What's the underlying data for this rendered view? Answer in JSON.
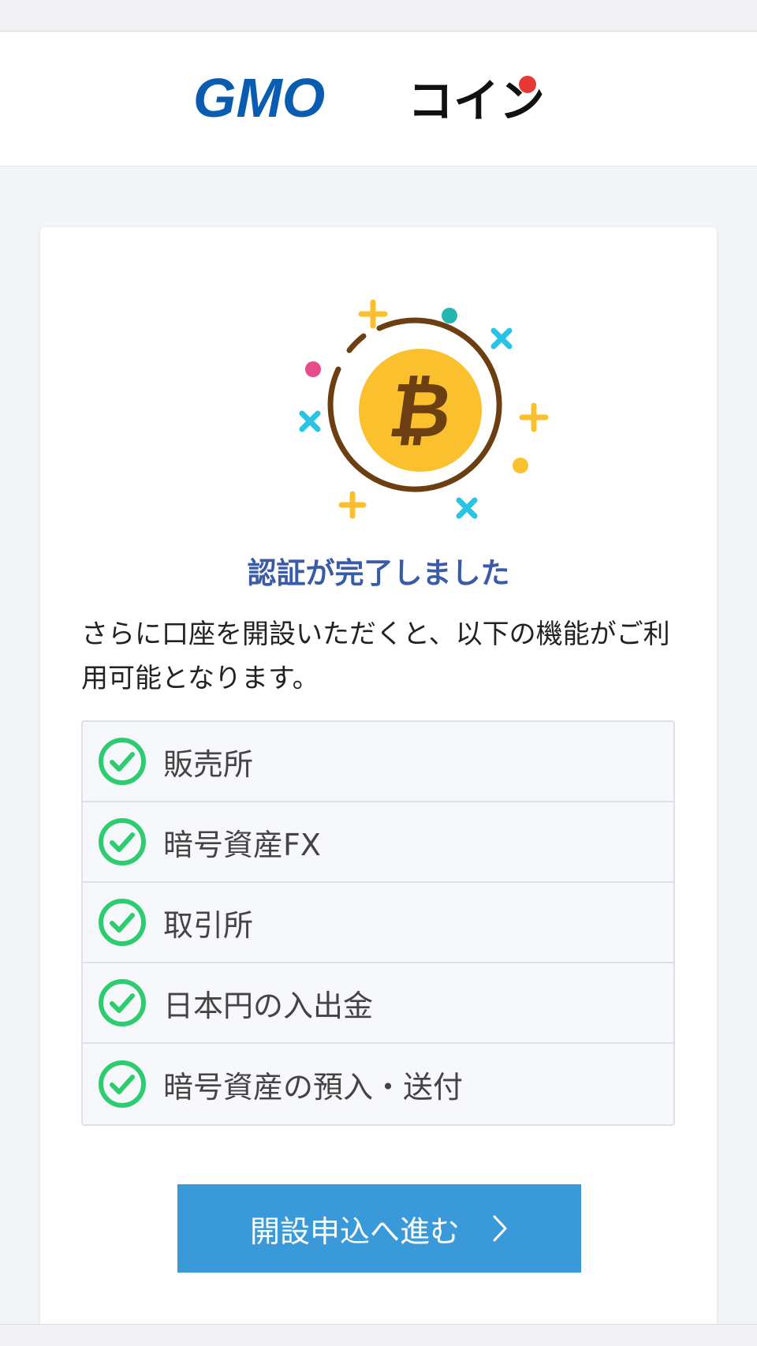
{
  "header": {
    "logo_text_latin": "GMO",
    "logo_text_kana": "コイン",
    "logo_name": "gmo-coin-logo"
  },
  "main": {
    "title": "認証が完了しました",
    "description": "さらに口座を開設いただくと、以下の機能がご利用可能となります。",
    "features": [
      "販売所",
      "暗号資産FX",
      "取引所",
      "日本円の入出金",
      "暗号資産の預入・送付"
    ],
    "cta_label": "開設申込へ進む"
  },
  "colors": {
    "brand_blue": "#0a5cb0",
    "title_blue": "#3a5ca8",
    "button_blue": "#3a9ad9",
    "check_green": "#2ecc71",
    "coin_yellow": "#fbc02d",
    "coin_ring": "#6b3f12"
  },
  "icons": {
    "feature_icon": "check-circle-icon",
    "cta_icon": "chevron-right-icon",
    "hero": "bitcoin-icon"
  }
}
